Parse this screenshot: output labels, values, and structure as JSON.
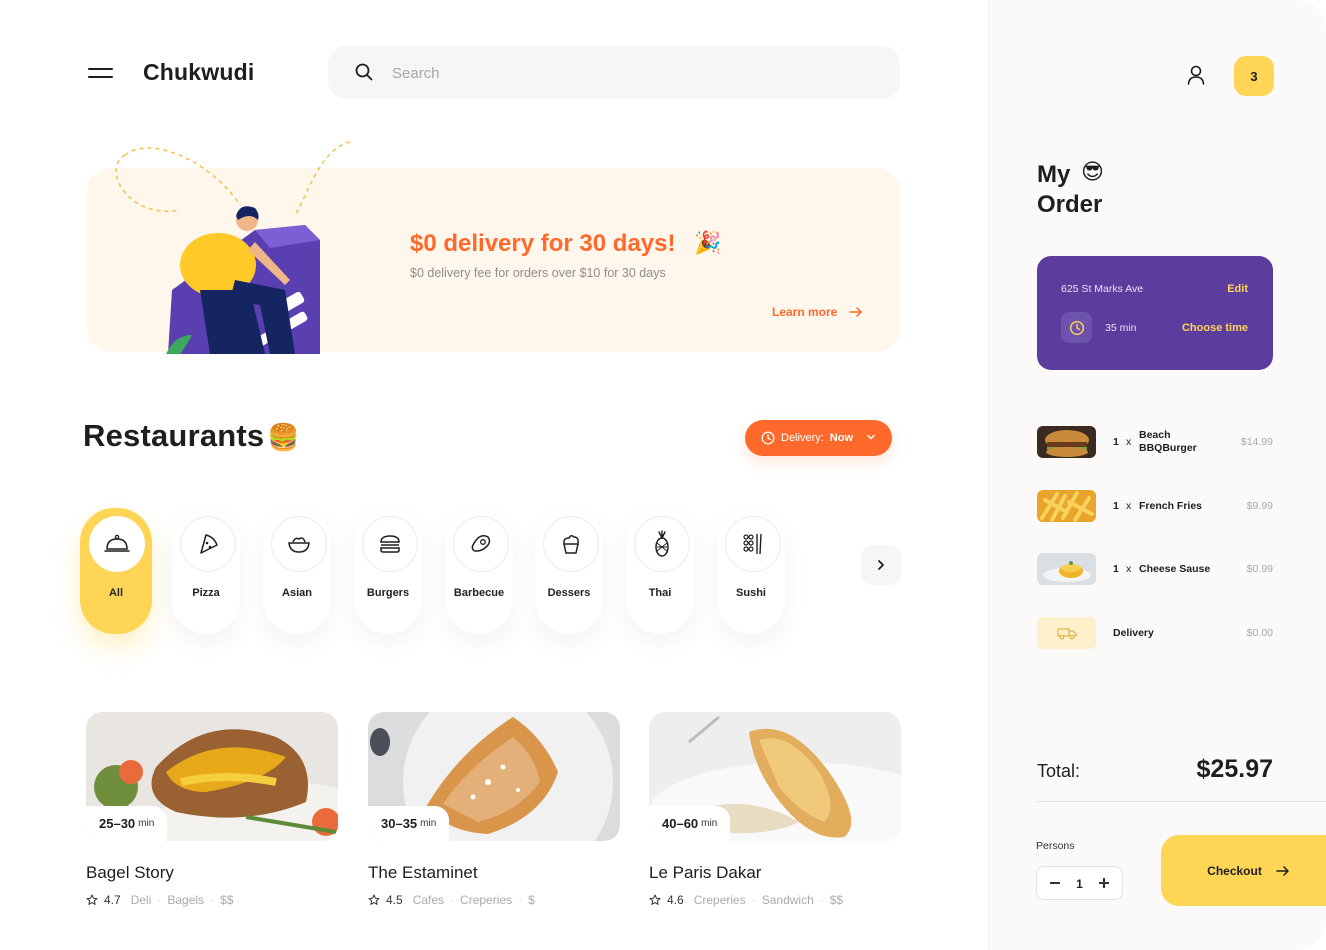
{
  "header": {
    "brand": "Chukwudi",
    "search_placeholder": "Search"
  },
  "promo": {
    "title": "$0 delivery for 30 days!",
    "emoji": "🎉",
    "subtitle": "$0 delivery fee for orders over $10 for 30 days",
    "cta": "Learn more"
  },
  "restaurants": {
    "title": "Restaurants",
    "emoji": "🍔",
    "delivery_label": "Delivery:",
    "delivery_value": "Now"
  },
  "categories": [
    {
      "label": "All",
      "icon": "cloche-icon",
      "active": true
    },
    {
      "label": "Pizza",
      "icon": "pizza-icon"
    },
    {
      "label": "Asian",
      "icon": "bowl-icon"
    },
    {
      "label": "Burgers",
      "icon": "burger-icon"
    },
    {
      "label": "Barbecue",
      "icon": "steak-icon"
    },
    {
      "label": "Dessers",
      "icon": "cupcake-icon"
    },
    {
      "label": "Thai",
      "icon": "pineapple-icon"
    },
    {
      "label": "Sushi",
      "icon": "sushi-icon"
    }
  ],
  "cards": [
    {
      "time": "25–30",
      "unit": "min",
      "name": "Bagel Story",
      "rating": "4.7",
      "tags": [
        "Deli",
        "Bagels",
        "$$"
      ]
    },
    {
      "time": "30–35",
      "unit": "min",
      "name": "The Estaminet",
      "rating": "4.5",
      "tags": [
        "Cafes",
        "Creperies",
        "$"
      ]
    },
    {
      "time": "40–60",
      "unit": "min",
      "name": "Le Paris Dakar",
      "rating": "4.6",
      "tags": [
        "Creperies",
        "Sandwich",
        "$$"
      ]
    }
  ],
  "sidebar": {
    "cart_count": "3",
    "order_title_line1": "My",
    "order_title_line2": "Order",
    "order_emoji": "😎",
    "address": "625 St Marks Ave",
    "edit": "Edit",
    "eta": "35 min",
    "choose_time": "Choose time",
    "items": [
      {
        "qty": "1",
        "x": "x",
        "name": "Beach BBQBurger",
        "price": "$14.99"
      },
      {
        "qty": "1",
        "x": "x",
        "name": "French Fries",
        "price": "$9.99"
      },
      {
        "qty": "1",
        "x": "x",
        "name": "Cheese Sause",
        "price": "$0.99"
      }
    ],
    "delivery": {
      "name": "Delivery",
      "price": "$0.00"
    },
    "total_label": "Total:",
    "total_value": "$25.97",
    "persons_label": "Persons",
    "persons_value": "1",
    "checkout": "Checkout"
  },
  "colors": {
    "accent_yellow": "#ffd556",
    "accent_orange": "#ff6a2c",
    "accent_purple": "#5b3d9e",
    "promo_bg": "#fff6ec"
  }
}
